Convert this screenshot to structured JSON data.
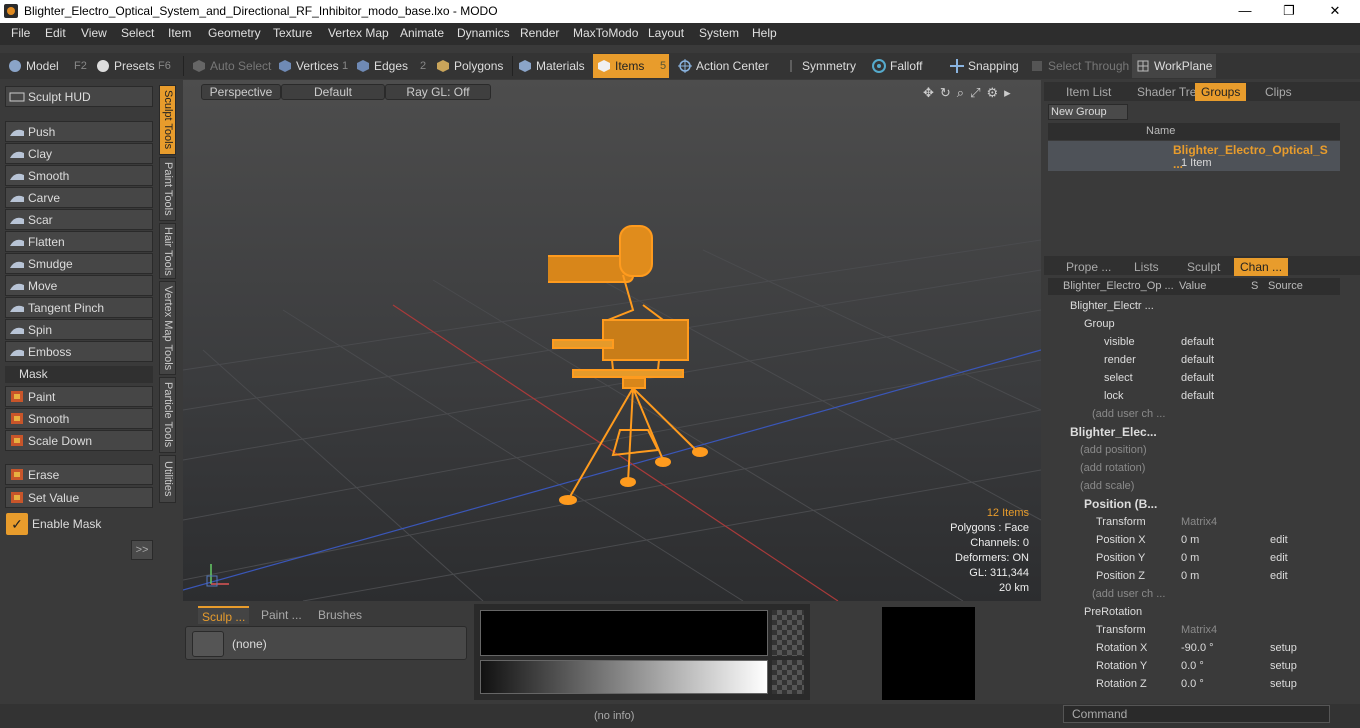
{
  "window": {
    "title": "Blighter_Electro_Optical_System_and_Directional_RF_Inhibitor_modo_base.lxo - MODO",
    "minimize": "—",
    "maximize": "❐",
    "close": "✕"
  },
  "menu": [
    "File",
    "Edit",
    "View",
    "Select",
    "Item",
    "Geometry",
    "Texture",
    "Vertex Map",
    "Animate",
    "Dynamics",
    "Render",
    "MaxToModo",
    "Layout",
    "System",
    "Help"
  ],
  "toolbar": {
    "model": "Model",
    "model_key": "F2",
    "presets": "Presets",
    "presets_key": "F6",
    "auto_select": "Auto Select",
    "vertices": "Vertices",
    "vertices_key": "1",
    "edges": "Edges",
    "edges_key": "2",
    "polygons": "Polygons",
    "materials": "Materials",
    "items": "Items",
    "items_key": "5",
    "action_center": "Action Center",
    "symmetry": "Symmetry",
    "falloff": "Falloff",
    "snapping": "Snapping",
    "select_through": "Select Through",
    "workplane": "WorkPlane"
  },
  "left": {
    "sculpt_hud": "Sculpt HUD",
    "tools": [
      "Push",
      "Clay",
      "Smooth",
      "Carve",
      "Scar",
      "Flatten",
      "Smudge",
      "Move",
      "Tangent Pinch",
      "Spin",
      "Emboss"
    ],
    "mask_header": "Mask",
    "mask_tools": [
      "Paint",
      "Smooth",
      "Scale Down"
    ],
    "erase": "Erase",
    "set_value": "Set Value",
    "enable_mask": "Enable Mask",
    "expand": ">>",
    "vtabs": [
      "Sculpt Tools",
      "Paint Tools",
      "Hair Tools",
      "Vertex Map Tools",
      "Particle Tools",
      "Utilities"
    ]
  },
  "viewport": {
    "perspective": "Perspective",
    "default": "Default",
    "raygl": "Ray GL: Off",
    "items": "12 Items",
    "polygons": "Polygons : Face",
    "channels": "Channels: 0",
    "deformers": "Deformers: ON",
    "gl": "GL: 311,344",
    "distance": "20 km"
  },
  "bottom": {
    "tabs": [
      "Sculp ...",
      "Paint ...",
      "Brushes"
    ],
    "none": "(none)",
    "info": "(no info)"
  },
  "right": {
    "top_tabs": [
      "Item List",
      "Shader Tree",
      "Groups",
      "Clips"
    ],
    "new_group": "New Group",
    "col_name": "Name",
    "group_name": "Blighter_Electro_Optical_S ...",
    "group_count": "1 Item",
    "prop_tabs": [
      "Prope ...",
      "Lists",
      "Sculpt",
      "Chan ..."
    ],
    "cols": [
      "Blighter_Electro_Op ...",
      "Value",
      "S",
      "Source"
    ],
    "rows": [
      {
        "n": "Blighter_Electr ...",
        "v": "",
        "s": ""
      },
      {
        "n": "Group",
        "v": "",
        "s": ""
      },
      {
        "n": "visible",
        "v": "default",
        "s": ""
      },
      {
        "n": "render",
        "v": "default",
        "s": ""
      },
      {
        "n": "select",
        "v": "default",
        "s": ""
      },
      {
        "n": "lock",
        "v": "default",
        "s": ""
      },
      {
        "n": "(add user ch ...",
        "v": "",
        "s": ""
      },
      {
        "n": "Blighter_Elec...",
        "v": "",
        "s": ""
      },
      {
        "n": "(add position)",
        "v": "",
        "s": ""
      },
      {
        "n": "(add rotation)",
        "v": "",
        "s": ""
      },
      {
        "n": "(add scale)",
        "v": "",
        "s": ""
      },
      {
        "n": "Position (B...",
        "v": "",
        "s": ""
      },
      {
        "n": "Transform",
        "v": "Matrix4",
        "s": ""
      },
      {
        "n": "Position X",
        "v": "0 m",
        "s": "edit"
      },
      {
        "n": "Position Y",
        "v": "0 m",
        "s": "edit"
      },
      {
        "n": "Position Z",
        "v": "0 m",
        "s": "edit"
      },
      {
        "n": "(add user ch ...",
        "v": "",
        "s": ""
      },
      {
        "n": "PreRotation",
        "v": "",
        "s": ""
      },
      {
        "n": "Transform",
        "v": "Matrix4",
        "s": ""
      },
      {
        "n": "Rotation X",
        "v": "-90.0 °",
        "s": "setup"
      },
      {
        "n": "Rotation Y",
        "v": "0.0 °",
        "s": "setup"
      },
      {
        "n": "Rotation Z",
        "v": "0.0 °",
        "s": "setup"
      }
    ],
    "command": "Command"
  },
  "colors": {
    "accent": "#e89c2c"
  }
}
